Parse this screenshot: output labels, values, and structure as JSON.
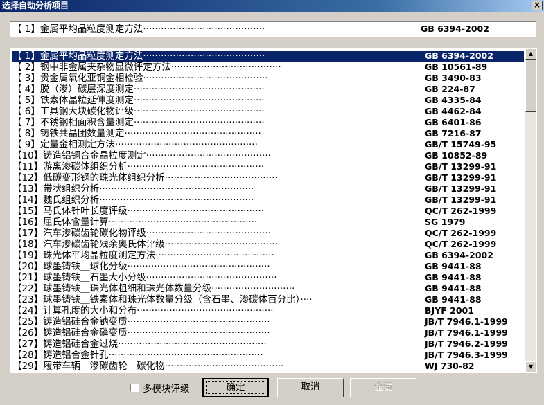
{
  "window": {
    "title": "选择自动分析项目",
    "close_label": "×"
  },
  "selected": {
    "label": "【 1】金属平均晶粒度测定方法·········································",
    "standard": "GB 6394-2002"
  },
  "list": {
    "selected_index": 0,
    "scroll_up": "▲",
    "scroll_down": "▼",
    "items": [
      {
        "label": "【 1】金属平均晶粒度测定方法·········································",
        "standard": "GB 6394-2002"
      },
      {
        "label": "【 2】钢中非金属夹杂物显微评定方法·····································",
        "standard": "GB 10561-89"
      },
      {
        "label": "【 3】贵金属氧化亚铜金相检验··········································",
        "standard": "GB 3490-83"
      },
      {
        "label": "【 4】脱（渗）碳层深度测定············································",
        "standard": "GB 224-87"
      },
      {
        "label": "【 5】铁素体晶粒延伸度测定············································",
        "standard": "GB 4335-84"
      },
      {
        "label": "【 6】工具钢大块碳化物评级············································",
        "standard": "GB 4462-84"
      },
      {
        "label": "【 7】不锈钢相面积含量测定············································",
        "standard": "GB 6401-86"
      },
      {
        "label": "【 8】铸铁共晶团数量测定··············································",
        "standard": "GB 7216-87"
      },
      {
        "label": "【 9】定量金相测定方法················································",
        "standard": "GB/T 15749-95"
      },
      {
        "label": "【10】铸造铝铜合金晶粒度测定··········································",
        "standard": "GB 10852-89"
      },
      {
        "label": "【11】游离渗碳体组织分析··············································",
        "standard": "GB/T 13299-91"
      },
      {
        "label": "【12】低碳变形钢的珠光体组织分析······································",
        "standard": "GB/T 13299-91"
      },
      {
        "label": "【13】带状组织分析····················································",
        "standard": "GB/T 13299-91"
      },
      {
        "label": "【14】魏氏组织分析····················································",
        "standard": "GB/T 13299-91"
      },
      {
        "label": "【15】马氏体针叶长度评级··············································",
        "standard": "QC/T 262-1999"
      },
      {
        "label": "【16】屈氏体含量计算··················································",
        "standard": "SG 1979"
      },
      {
        "label": "【17】汽车渗碳齿轮碳化物评级··········································",
        "standard": "QC/T 262-1999"
      },
      {
        "label": "【18】汽车渗碳齿轮残余奥氏体评级······································",
        "standard": "QC/T 262-1999"
      },
      {
        "label": "【19】珠光体平均晶粒度测定方法········································",
        "standard": "GB 6394-2002"
      },
      {
        "label": "【20】球墨铸铁＿球化分级················································",
        "standard": "GB 9441-88"
      },
      {
        "label": "【21】球墨铸铁＿石墨大小分级············································",
        "standard": "GB 9441-88"
      },
      {
        "label": "【22】球墨铸铁＿珠光体粗细和珠光体数量分级····························",
        "standard": "GB 9441-88"
      },
      {
        "label": "【23】球墨铸铁＿铁素体和珠光体数量分级（含石墨、渗碳体百分比）····",
        "standard": "GB 9441-88"
      },
      {
        "label": "【24】计算孔度的大小和分布··············································",
        "standard": "BJYF 2001"
      },
      {
        "label": "【25】铸造铝硅合金钠变质················································",
        "standard": "JB/T 7946.1-1999"
      },
      {
        "label": "【26】铸造铝硅合金磷变质················································",
        "standard": "JB/T 7946.1-1999"
      },
      {
        "label": "【27】铸造铝硅合金过烧··················································",
        "standard": "JB/T 7946.2-1999"
      },
      {
        "label": "【28】铸造铝合金针孔····················································",
        "standard": "JB/T 7946.3-1999"
      },
      {
        "label": "【29】履带车辆＿渗碳齿轮＿碳化物········································",
        "standard": "WJ 730-82"
      }
    ]
  },
  "footer": {
    "multi_module_label": "多模块评级",
    "confirm_label": "确定",
    "cancel_label": "取消",
    "select_all_label": "全清"
  }
}
